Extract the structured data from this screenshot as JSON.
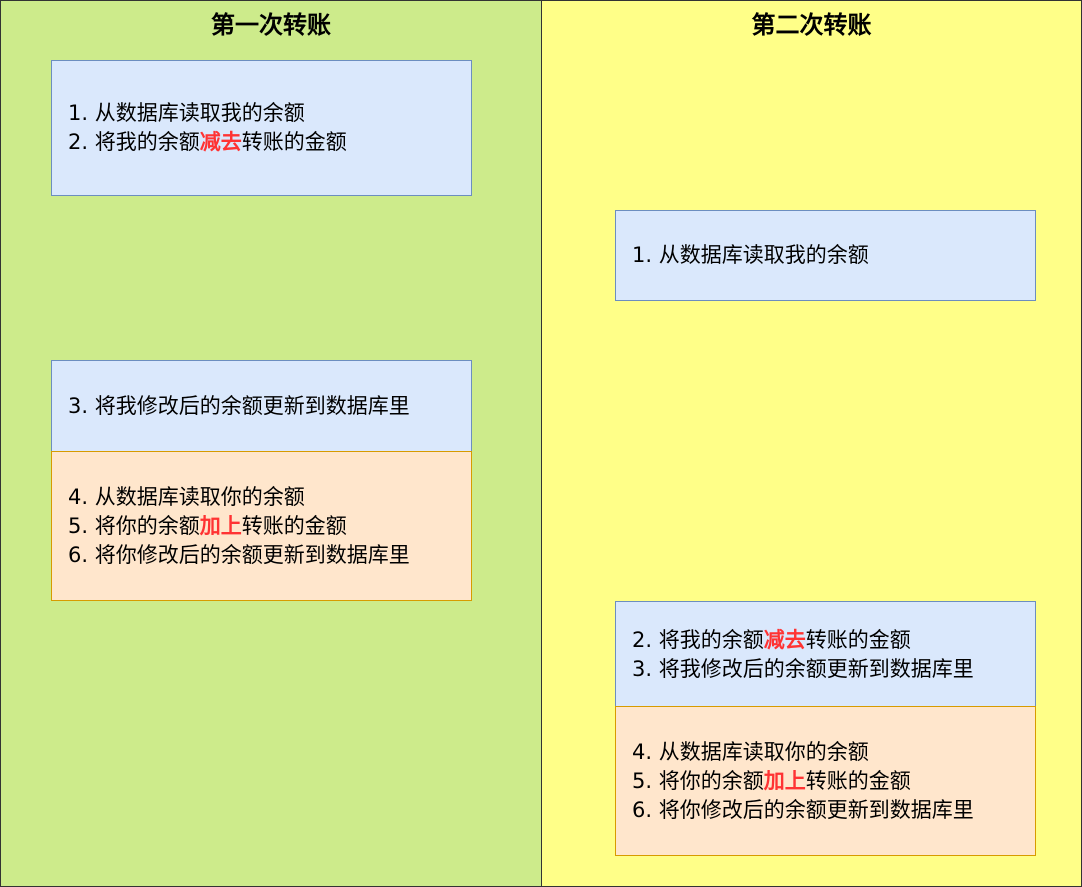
{
  "columns": [
    {
      "title": "第一次转账",
      "boxes": [
        {
          "style": "blue",
          "lines": [
            {
              "pre": "1. 从数据库读取我的余额",
              "hl": "",
              "post": ""
            },
            {
              "pre": "2. 将我的余额",
              "hl": "减去",
              "post": "转账的金额"
            }
          ]
        },
        {
          "style": "blue",
          "lines": [
            {
              "pre": "3. 将我修改后的余额更新到数据库里",
              "hl": "",
              "post": ""
            }
          ]
        },
        {
          "style": "orange",
          "lines": [
            {
              "pre": "4. 从数据库读取你的余额",
              "hl": "",
              "post": ""
            },
            {
              "pre": "5. 将你的余额",
              "hl": "加上",
              "post": "转账的金额"
            },
            {
              "pre": "6. 将你修改后的余额更新到数据库里",
              "hl": "",
              "post": ""
            }
          ]
        }
      ]
    },
    {
      "title": "第二次转账",
      "boxes": [
        {
          "style": "blue",
          "lines": [
            {
              "pre": "1. 从数据库读取我的余额",
              "hl": "",
              "post": ""
            }
          ]
        },
        {
          "style": "blue",
          "lines": [
            {
              "pre": "2. 将我的余额",
              "hl": "减去",
              "post": "转账的金额"
            },
            {
              "pre": "3. 将我修改后的余额更新到数据库里",
              "hl": "",
              "post": ""
            }
          ]
        },
        {
          "style": "orange",
          "lines": [
            {
              "pre": "4. 从数据库读取你的余额",
              "hl": "",
              "post": ""
            },
            {
              "pre": "5. 将你的余额",
              "hl": "加上",
              "post": "转账的金额"
            },
            {
              "pre": "6. 将你修改后的余额更新到数据库里",
              "hl": "",
              "post": ""
            }
          ]
        }
      ]
    }
  ],
  "colors": {
    "column1_bg": "#cdeb8b",
    "column2_bg": "#ffff88",
    "blue_box_bg": "#dae8fc",
    "blue_box_border": "#6c8ebf",
    "orange_box_bg": "#ffe6cc",
    "orange_box_border": "#d79b00",
    "highlight": "#ff3333"
  }
}
